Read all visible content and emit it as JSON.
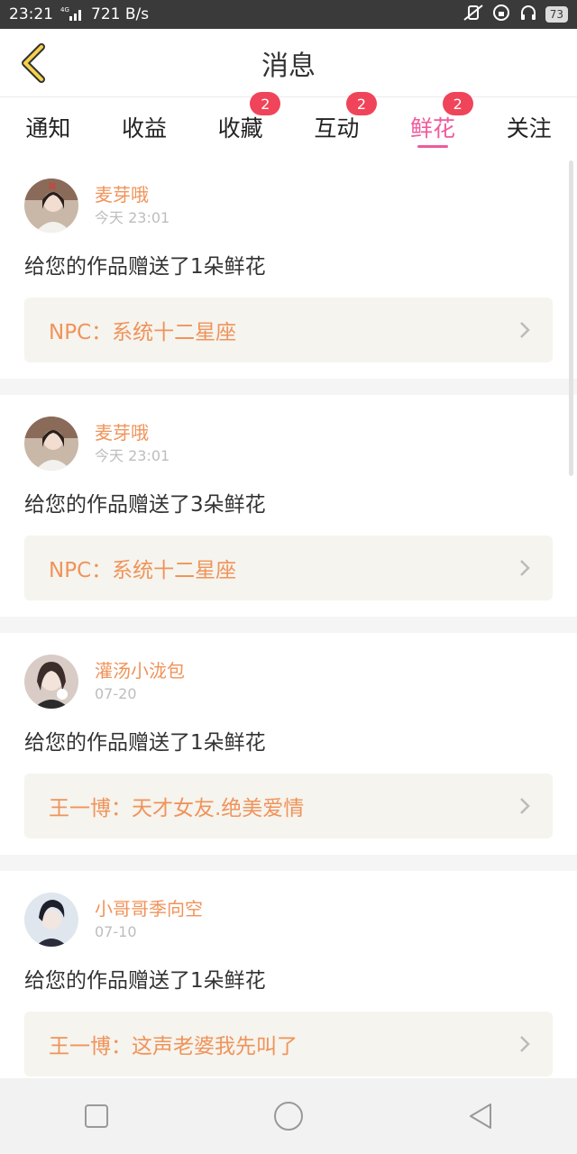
{
  "status_bar": {
    "time": "23:21",
    "network": "4G",
    "speed": "721 B/s",
    "battery": "73"
  },
  "header": {
    "title": "消息",
    "back_icon": "chevron-left-icon",
    "accent_color": "#f5d24a"
  },
  "tabs": [
    {
      "label": "通知",
      "badge": ""
    },
    {
      "label": "收益",
      "badge": ""
    },
    {
      "label": "收藏",
      "badge": "2"
    },
    {
      "label": "互动",
      "badge": "2"
    },
    {
      "label": "鲜花",
      "badge": "2",
      "active": true
    },
    {
      "label": "关注",
      "badge": ""
    }
  ],
  "messages": [
    {
      "user": "麦芽哦",
      "time": "今天 23:01",
      "text": "给您的作品赠送了1朵鲜花",
      "work": "NPC：系统十二星座"
    },
    {
      "user": "麦芽哦",
      "time": "今天 23:01",
      "text": "给您的作品赠送了3朵鲜花",
      "work": "NPC：系统十二星座"
    },
    {
      "user": "灌汤小泷包",
      "time": "07-20",
      "text": "给您的作品赠送了1朵鲜花",
      "work": "王一博：天才女友.绝美爱情"
    },
    {
      "user": "小哥哥季向空",
      "time": "07-10",
      "text": "给您的作品赠送了1朵鲜花",
      "work": "王一博：这声老婆我先叫了"
    }
  ],
  "colors": {
    "active_tab": "#ef5b9c",
    "badge": "#f0445a",
    "username": "#f0935a",
    "work_bg": "#f5f4ee"
  },
  "nav": {
    "recent_icon": "square-icon",
    "home_icon": "circle-icon",
    "back_icon": "triangle-back-icon"
  }
}
